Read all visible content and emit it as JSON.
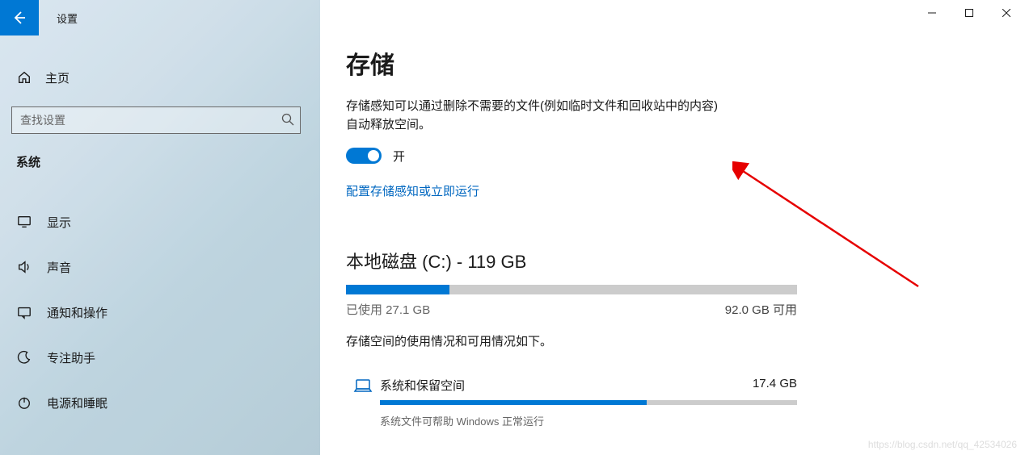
{
  "app_title": "设置",
  "home_label": "主页",
  "search_placeholder": "查找设置",
  "category_header": "系统",
  "nav_items": [
    {
      "label": "显示"
    },
    {
      "label": "声音"
    },
    {
      "label": "通知和操作"
    },
    {
      "label": "专注助手"
    },
    {
      "label": "电源和睡眠"
    }
  ],
  "page": {
    "title": "存储",
    "description_line1": "存储感知可以通过删除不需要的文件(例如临时文件和回收站中的内容)",
    "description_line2": "自动释放空间。",
    "toggle_label": "开",
    "configure_link": "配置存储感知或立即运行",
    "disk": {
      "title": "本地磁盘 (C:) - 119 GB",
      "used_pct": 23,
      "used_text": "已使用 27.1 GB",
      "free_text": "92.0 GB 可用",
      "note": "存储空间的使用情况和可用情况如下。"
    },
    "category": {
      "name": "系统和保留空间",
      "size": "17.4 GB",
      "fill_pct": 64,
      "desc": "系统文件可帮助 Windows 正常运行"
    }
  },
  "watermark": "https://blog.csdn.net/qq_42534026"
}
